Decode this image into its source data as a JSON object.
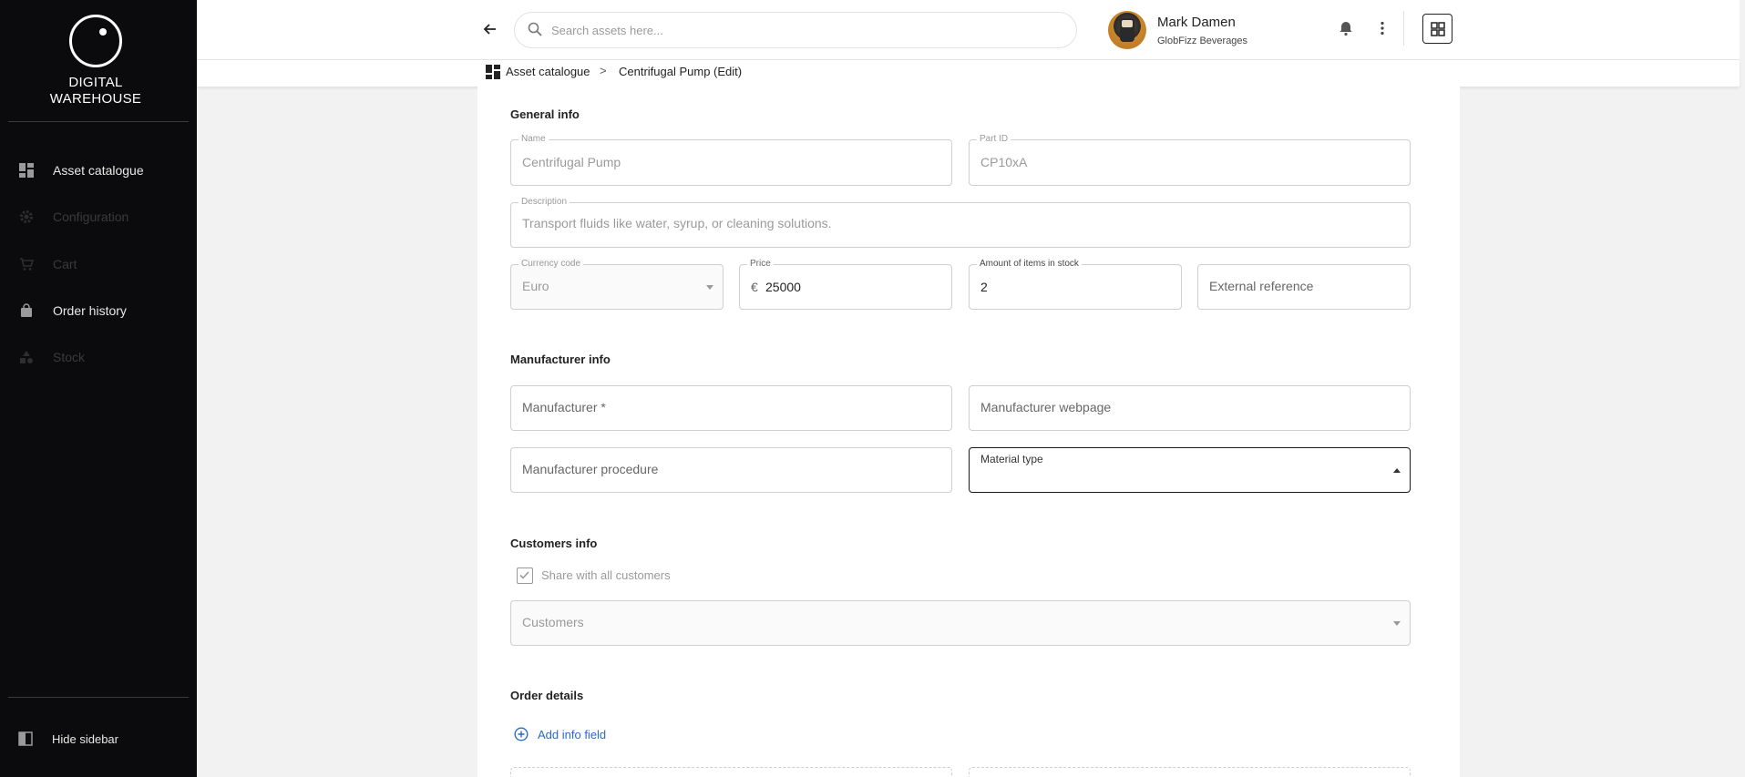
{
  "app": {
    "logo_line1": "DIGITAL",
    "logo_line2": "WAREHOUSE"
  },
  "sidebar": {
    "items": [
      {
        "label": "Asset catalogue",
        "icon": "dashboard-icon",
        "state": "active"
      },
      {
        "label": "Configuration",
        "icon": "gear-icon",
        "state": "disabled"
      },
      {
        "label": "Cart",
        "icon": "cart-icon",
        "state": "disabled"
      },
      {
        "label": "Order history",
        "icon": "shopping-bag-icon",
        "state": "active"
      },
      {
        "label": "Stock",
        "icon": "stock-icon",
        "state": "disabled"
      }
    ],
    "hide_label": "Hide sidebar"
  },
  "header": {
    "search_placeholder": "Search assets here...",
    "user_name": "Mark Damen",
    "user_org": "GlobFizz Beverages"
  },
  "breadcrumb": {
    "root": "Asset catalogue",
    "separator": ">",
    "current": "Centrifugal Pump (Edit)"
  },
  "form": {
    "general": {
      "title": "General info",
      "name_label": "Name",
      "name_value": "Centrifugal Pump",
      "partid_label": "Part ID",
      "partid_value": "CP10xA",
      "description_label": "Description",
      "description_value": "Transport fluids like water, syrup, or cleaning solutions.",
      "currency_label": "Currency code",
      "currency_value": "Euro",
      "price_label": "Price",
      "price_symbol": "€",
      "price_value": "25000",
      "stock_label": "Amount of items in stock",
      "stock_value": "2",
      "external_ref_placeholder": "External reference"
    },
    "manufacturer": {
      "title": "Manufacturer info",
      "manufacturer_placeholder": "Manufacturer *",
      "webpage_placeholder": "Manufacturer webpage",
      "procedure_placeholder": "Manufacturer procedure",
      "material_type_label": "Material type"
    },
    "customers": {
      "title": "Customers info",
      "share_label": "Share with all customers",
      "share_checked": true,
      "customers_placeholder": "Customers"
    },
    "order": {
      "title": "Order details",
      "add_info_label": "Add info field"
    }
  }
}
